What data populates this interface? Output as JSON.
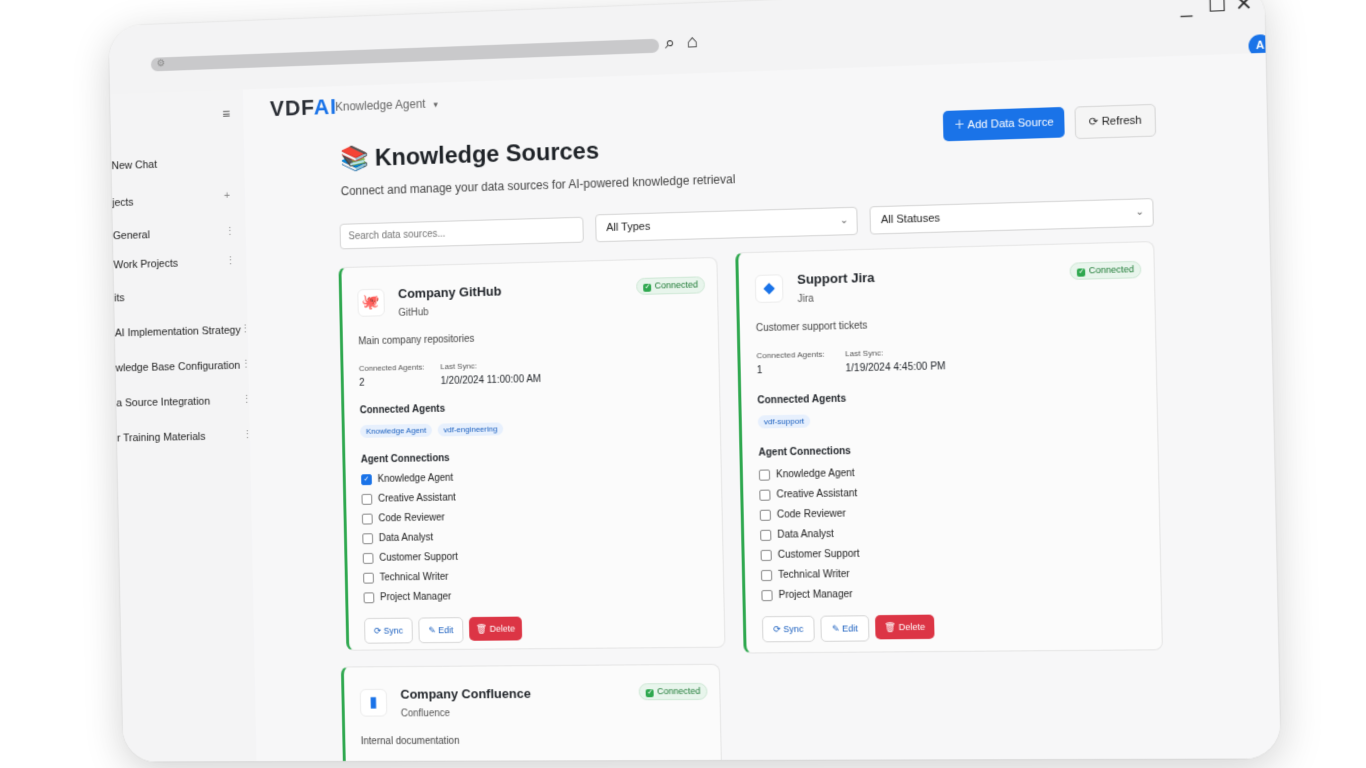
{
  "browser": {
    "address_bar": "",
    "search_icon": "search-icon",
    "home_icon": "home-icon",
    "window_controls": [
      "minimize-icon",
      "maximize-icon",
      "close-icon"
    ]
  },
  "user": {
    "avatar_initial": "A"
  },
  "sidebar": {
    "menu_icon": "hamburger-icon",
    "new_chat": "New Chat",
    "projects_label": "jects",
    "add_project": "+",
    "projects": [
      "General",
      "Work Projects"
    ],
    "chats_label": "its",
    "chats": [
      "AI Implementation Strategy",
      "wledge Base Configuration",
      "a Source Integration",
      "r Training Materials"
    ],
    "item_menu": "⋮"
  },
  "header": {
    "logo_main": "VDF",
    "logo_accent": "AI",
    "agent_name": "Knowledge Agent",
    "agent_caret": "▾"
  },
  "page": {
    "title_icon": "books-icon",
    "title": "Knowledge Sources",
    "subtitle": "Connect and manage your data sources for AI-powered knowledge retrieval",
    "add_button": "Add Data Source",
    "refresh_button": "Refresh"
  },
  "filters": {
    "search_placeholder": "Search data sources...",
    "type_filter": "All Types",
    "status_filter": "All Statuses"
  },
  "labels": {
    "connected_agents_count": "Connected Agents:",
    "last_sync": "Last Sync:",
    "connected_agents_section": "Connected Agents",
    "agent_connections_section": "Agent Connections",
    "sync": "Sync",
    "edit": "Edit",
    "delete": "Delete"
  },
  "agent_options": [
    "Knowledge Agent",
    "Creative Assistant",
    "Code Reviewer",
    "Data Analyst",
    "Customer Support",
    "Technical Writer",
    "Project Manager"
  ],
  "sources": [
    {
      "name": "Company GitHub",
      "type": "GitHub",
      "icon": "github-icon",
      "status": "Connected",
      "description": "Main company repositories",
      "connected_agents_count": "2",
      "last_sync": "1/20/2024 11:00:00 AM",
      "connected_agents": [
        "Knowledge Agent",
        "vdf-engineering"
      ],
      "checked": [
        true,
        false,
        false,
        false,
        false,
        false,
        false
      ]
    },
    {
      "name": "Support Jira",
      "type": "Jira",
      "icon": "jira-icon",
      "status": "Connected",
      "description": "Customer support tickets",
      "connected_agents_count": "1",
      "last_sync": "1/19/2024 4:45:00 PM",
      "connected_agents": [
        "vdf-support"
      ],
      "checked": [
        false,
        false,
        false,
        false,
        false,
        false,
        false
      ]
    },
    {
      "name": "Company Confluence",
      "type": "Confluence",
      "icon": "confluence-icon",
      "status": "Connected",
      "description": "Internal documentation"
    }
  ],
  "colors": {
    "accent": "#1a73e8",
    "success": "#2fa84f",
    "danger": "#dc3545"
  }
}
